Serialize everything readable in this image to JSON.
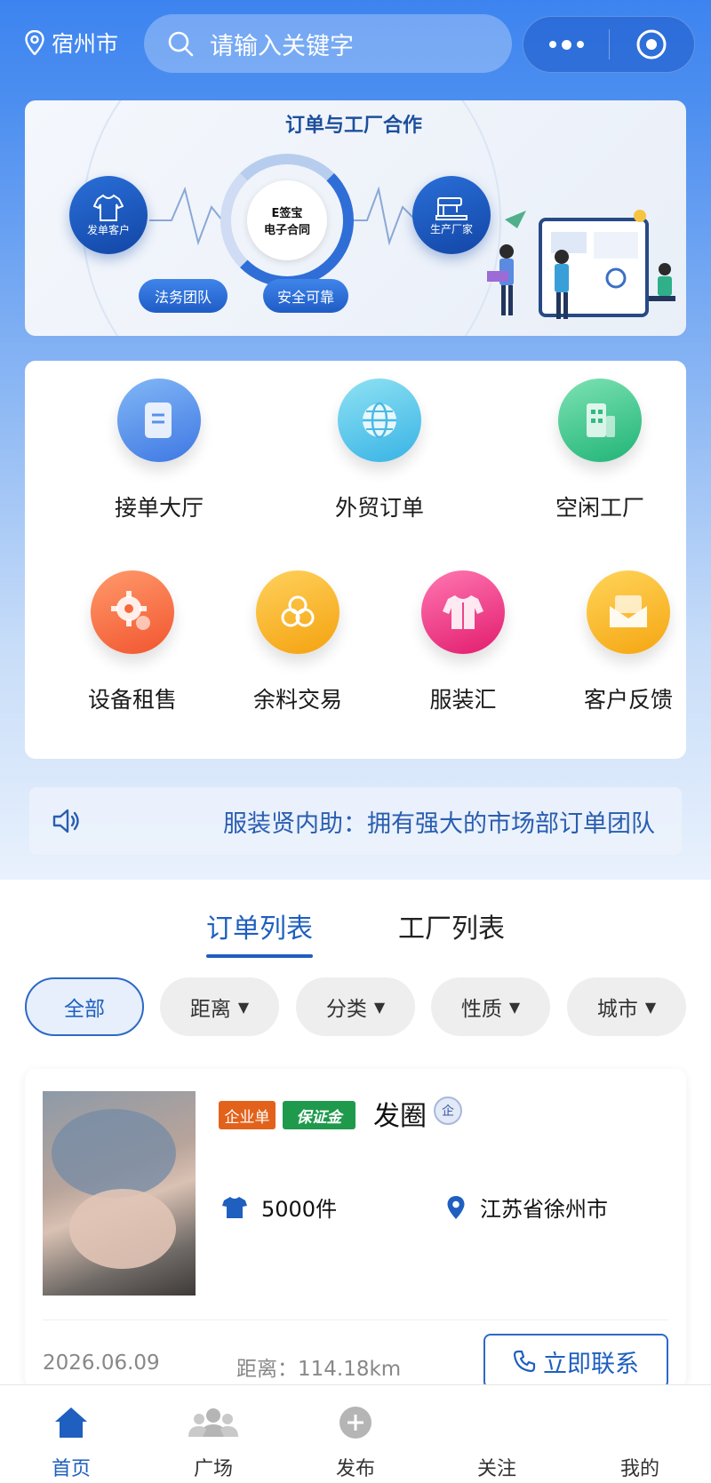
{
  "header": {
    "city": "宿州市",
    "search_placeholder": "请输入关键字"
  },
  "banner": {
    "title": "订单与工厂合作",
    "left_label": "发单客户",
    "right_label": "生产厂家",
    "center_line1": "E签宝",
    "center_line2": "电子合同",
    "pill_left": "法务团队",
    "pill_right": "安全可靠"
  },
  "menu": {
    "items": [
      {
        "label": "接单大厅",
        "icon": "document-icon"
      },
      {
        "label": "外贸订单",
        "icon": "globe-icon"
      },
      {
        "label": "空闲工厂",
        "icon": "building-icon"
      },
      {
        "label": "设备租售",
        "icon": "gear-icon"
      },
      {
        "label": "余料交易",
        "icon": "fabric-roll-icon"
      },
      {
        "label": "服装汇",
        "icon": "jacket-icon"
      },
      {
        "label": "客户反馈",
        "icon": "mail-icon"
      }
    ]
  },
  "notice": {
    "text": "服装贤内助：拥有强大的市场部订单团队"
  },
  "tabs": {
    "orders": "订单列表",
    "factories": "工厂列表"
  },
  "filters": {
    "all": "全部",
    "distance": "距离",
    "category": "分类",
    "nature": "性质",
    "city": "城市"
  },
  "order": {
    "tag_enterprise": "企业单",
    "tag_deposit": "保证金",
    "name": "发圈",
    "verified_badge": "企",
    "quantity": "5000件",
    "location": "江苏省徐州市",
    "date": "2026.06.09",
    "distance": "距离：114.18km",
    "contact_label": "立即联系"
  },
  "tabbar": {
    "home": "首页",
    "square": "广场",
    "publish": "发布",
    "follow": "关注",
    "mine": "我的"
  },
  "colors": {
    "primary": "#1e5fbf",
    "header_blue": "#3d84f0"
  }
}
